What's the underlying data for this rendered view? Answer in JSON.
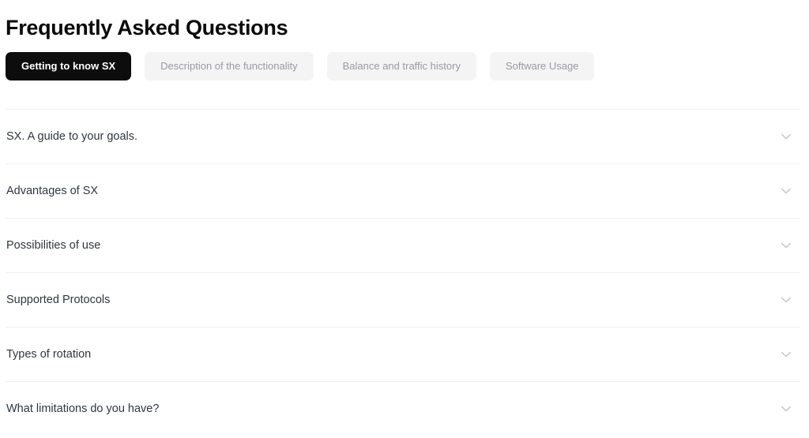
{
  "page": {
    "title": "Frequently Asked Questions"
  },
  "tabs": [
    {
      "label": "Getting to know SX",
      "active": true
    },
    {
      "label": "Description of the functionality",
      "active": false
    },
    {
      "label": "Balance and traffic history",
      "active": false
    },
    {
      "label": "Software Usage",
      "active": false
    }
  ],
  "faq_items": [
    {
      "question": "SX. A guide to your goals.",
      "expanded": false,
      "icon": "chevron-down-icon"
    },
    {
      "question": "Advantages of SX",
      "expanded": false,
      "icon": "chevron-down-icon"
    },
    {
      "question": "Possibilities of use",
      "expanded": false,
      "icon": "chevron-down-icon"
    },
    {
      "question": "Supported Protocols",
      "expanded": false,
      "icon": "chevron-down-icon"
    },
    {
      "question": "Types of rotation",
      "expanded": false,
      "icon": "chevron-down-icon"
    },
    {
      "question": "What limitations do you have?",
      "expanded": false,
      "icon": "chevron-down-icon"
    }
  ],
  "colors": {
    "active_tab_bg": "#0d0d0d",
    "active_tab_text": "#ffffff",
    "inactive_tab_bg": "#f4f4f5",
    "inactive_tab_text": "#9a9aa2",
    "title_text": "#0a0a0a",
    "item_text": "#30373f",
    "divider": "#f0f0f1",
    "chevron": "#c7c7cc",
    "page_bg": "#ffffff"
  }
}
